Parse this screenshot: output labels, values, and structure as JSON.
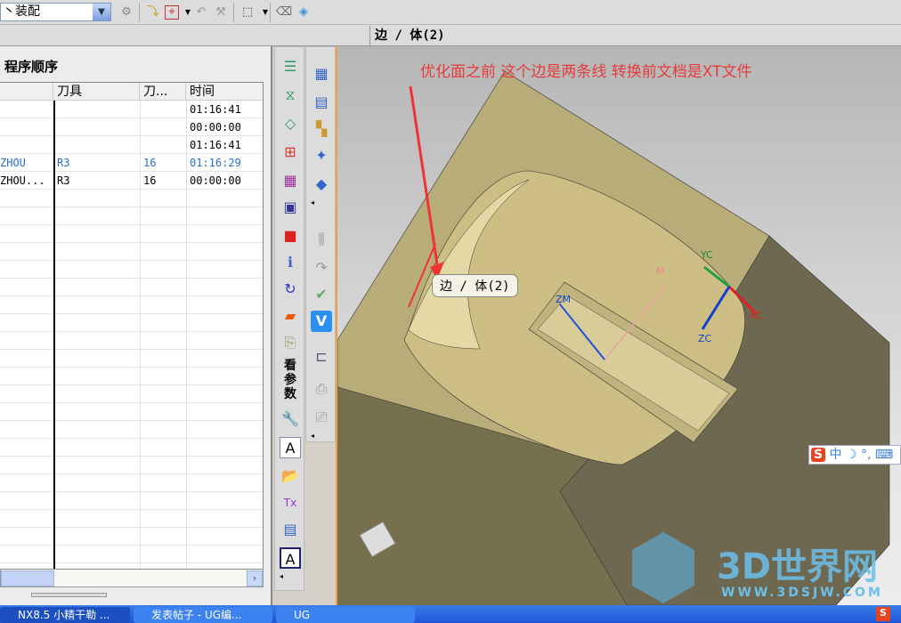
{
  "toolbar": {
    "assembly_combo": "丶装配",
    "combo_arrow": "▼"
  },
  "selection_info": "边 / 体(2)",
  "panel": {
    "title": "程序顺序",
    "columns": [
      "",
      "刀具",
      "刀...",
      "时间"
    ],
    "rows": [
      {
        "name": "",
        "tool": "",
        "num": "",
        "time": "01:16:41",
        "selected": false
      },
      {
        "name": "",
        "tool": "",
        "num": "",
        "time": "00:00:00",
        "selected": false
      },
      {
        "name": "",
        "tool": "",
        "num": "",
        "time": "01:16:41",
        "selected": false
      },
      {
        "name": "ZHOU",
        "tool": "R3",
        "num": "16",
        "time": "01:16:29",
        "selected": true
      },
      {
        "name": "ZHOU...",
        "tool": "R3",
        "num": "16",
        "time": "00:00:00",
        "selected": false
      }
    ]
  },
  "side_icon_text": "看参数",
  "viewport": {
    "annotation": "优化面之前 这个边是两条线    转换前文档是XT文件",
    "tooltip": "边 / 体(2)",
    "axes": {
      "yc": "YC",
      "xc": "XC",
      "zc": "ZC",
      "zm": "ZM",
      "m": "M"
    }
  },
  "ime": {
    "logo": "S",
    "mode": "中",
    "punct": "°,"
  },
  "watermark": {
    "title": "3D世界网",
    "url": "WWW.3DSJW.COM"
  },
  "taskbar": {
    "items": [
      "NX8.5 小精干勒 ...",
      "发表帖子 - UG编...",
      "UG"
    ]
  },
  "colors": {
    "annotation": "#e63b3b",
    "model_top": "#b8ad78",
    "model_side": "#6f6850",
    "selected_row": "#2a6fc9"
  }
}
